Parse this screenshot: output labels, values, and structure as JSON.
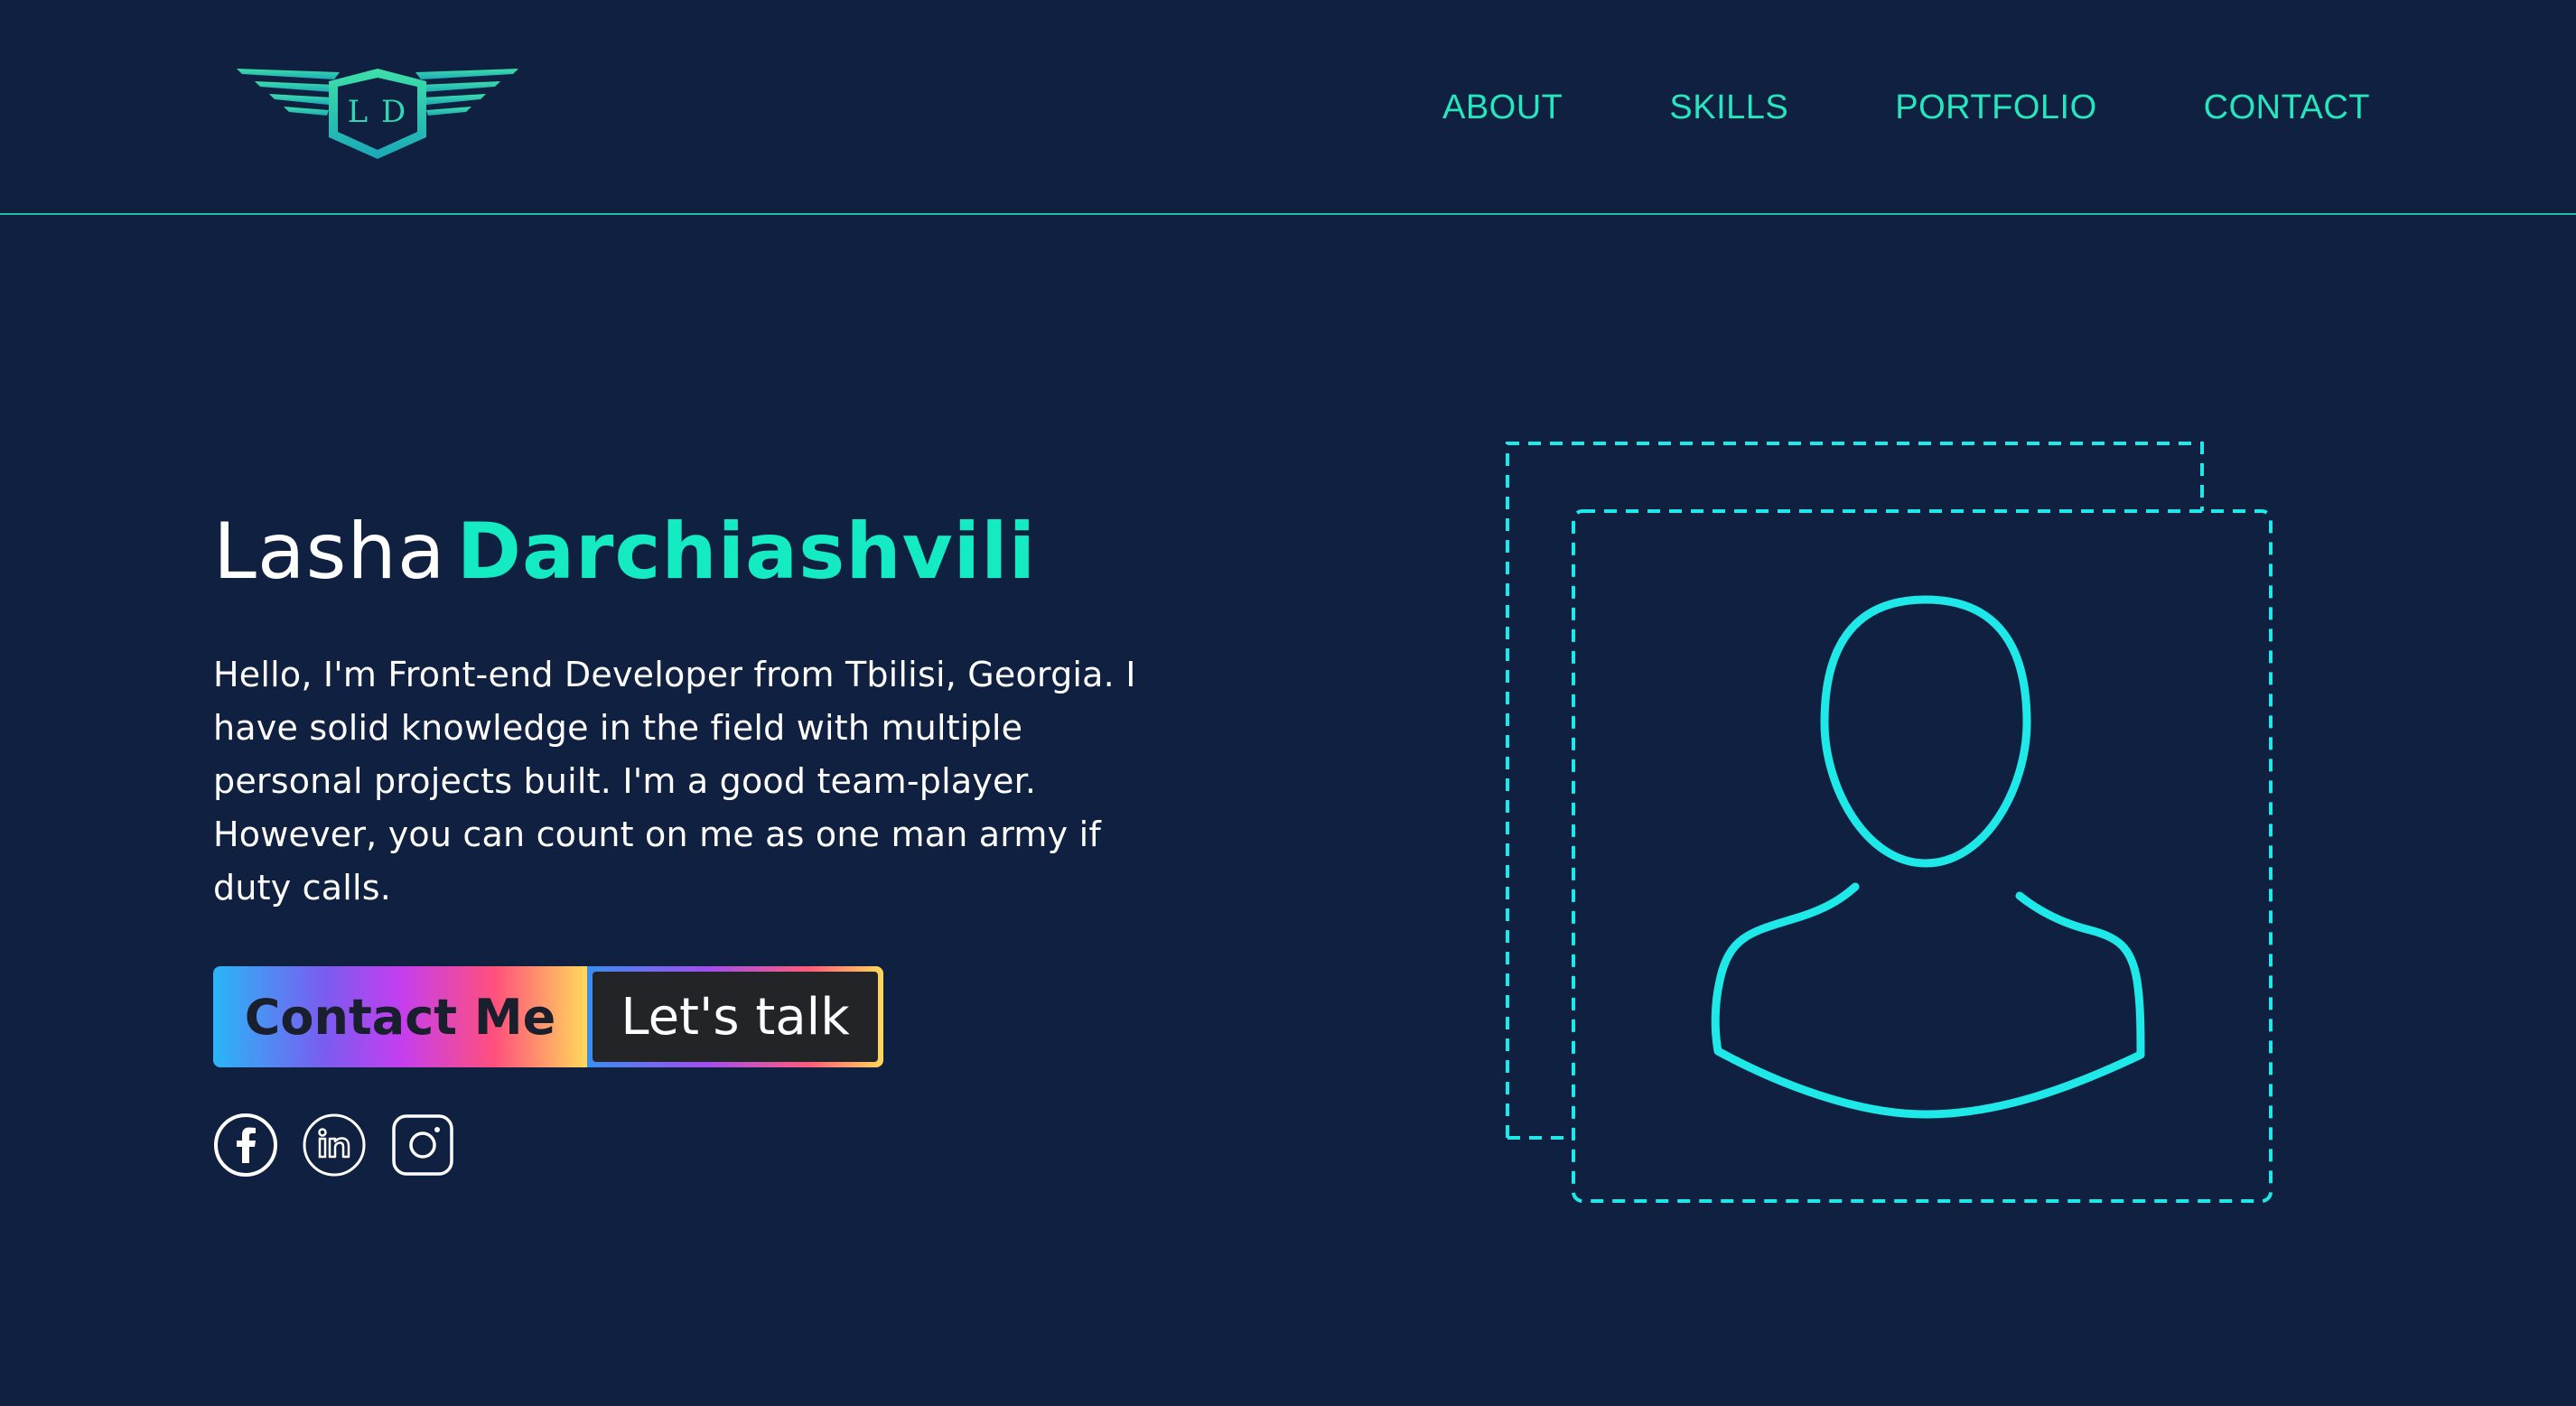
{
  "header": {
    "logo_initials": "L D",
    "nav": [
      {
        "label": "ABOUT"
      },
      {
        "label": "SKILLS"
      },
      {
        "label": "PORTFOLIO"
      },
      {
        "label": "CONTACT"
      }
    ]
  },
  "hero": {
    "first_name": "Lasha",
    "last_name": "Darchiashvili",
    "bio": "Hello, I'm Front-end Developer from Tbilisi, Georgia. I have solid knowledge in the field with multiple personal projects built. I'm a good team-player. However, you can count on me as one man army if duty calls.",
    "contact_button": "Contact Me",
    "talk_button": "Let's talk",
    "socials": [
      {
        "icon": "facebook-icon"
      },
      {
        "icon": "linkedin-icon"
      },
      {
        "icon": "instagram-icon"
      }
    ]
  },
  "colors": {
    "background": "#0f2040",
    "accent": "#14ebc3",
    "nav": "#25e6bd",
    "avatar_line": "#1ee8e8"
  }
}
